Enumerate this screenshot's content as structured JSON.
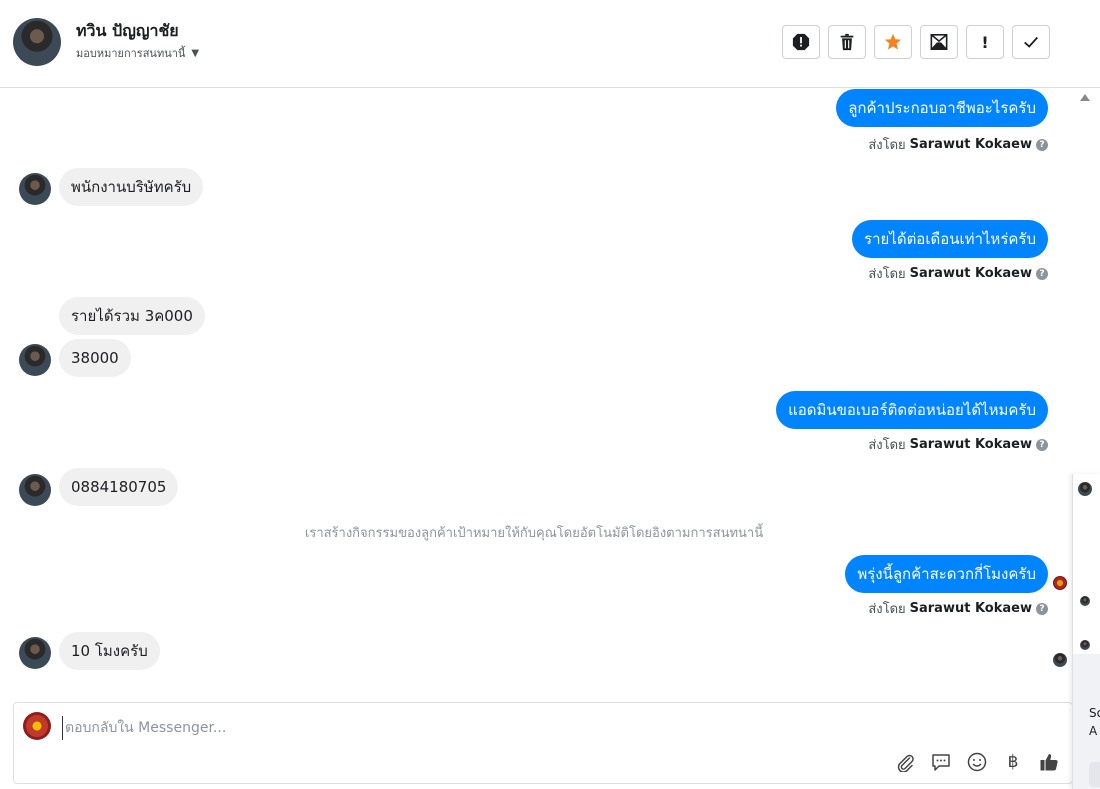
{
  "header": {
    "contact_name": "ทวิน ปัญญาชัย",
    "assign_label": "มอบหมายการสนทนานี้",
    "actions": [
      {
        "name": "report-spam-icon",
        "title": "Report"
      },
      {
        "name": "trash-icon",
        "title": "Delete"
      },
      {
        "name": "star-icon",
        "title": "Follow up"
      },
      {
        "name": "mark-unread-icon",
        "title": "Mark as unread"
      },
      {
        "name": "exclamation-icon",
        "glyph": "!"
      },
      {
        "name": "checkmark-icon",
        "title": "Done"
      }
    ]
  },
  "thread": {
    "messages": [
      {
        "dir": "out",
        "text": "ลูกค้าประกอบอาชีพอะไรครับ"
      },
      {
        "dir": "in",
        "text": "พนักงานบริษัทครับ"
      },
      {
        "dir": "out",
        "text": "รายได้ต่อเดือนเท่าไหร่ครับ"
      },
      {
        "dir": "in",
        "text": "รายได้รวม 3ค000"
      },
      {
        "dir": "in",
        "text": "38000"
      },
      {
        "dir": "out",
        "text": "แอดมินขอเบอร์ติดต่อหน่อยได้ไหมครับ"
      },
      {
        "dir": "in",
        "text": "0884180705"
      },
      {
        "dir": "out",
        "text": "พรุ่งนี้ลูกค้าสะดวกกี่โมงครับ"
      },
      {
        "dir": "in",
        "text": "10 โมงครับ"
      }
    ],
    "sent_by_prefix": "ส่งโดย",
    "sender_name": "Sarawut Kokaew",
    "help_glyph": "?",
    "system_note": "เราสร้างกิจกรรมของลูกค้าเป้าหมายให้กับคุณโดยอัตโนมัติโดยอิงตามการสนทนานี้"
  },
  "composer": {
    "placeholder": "ตอบกลับใน Messenger...",
    "currency_glyph": "฿"
  },
  "side_panel": {
    "text_line1": "So",
    "text_line2": "A"
  },
  "colors": {
    "accent": "#0084ff",
    "incoming_bubble": "#f1f0f0",
    "star": "#f5821f"
  }
}
